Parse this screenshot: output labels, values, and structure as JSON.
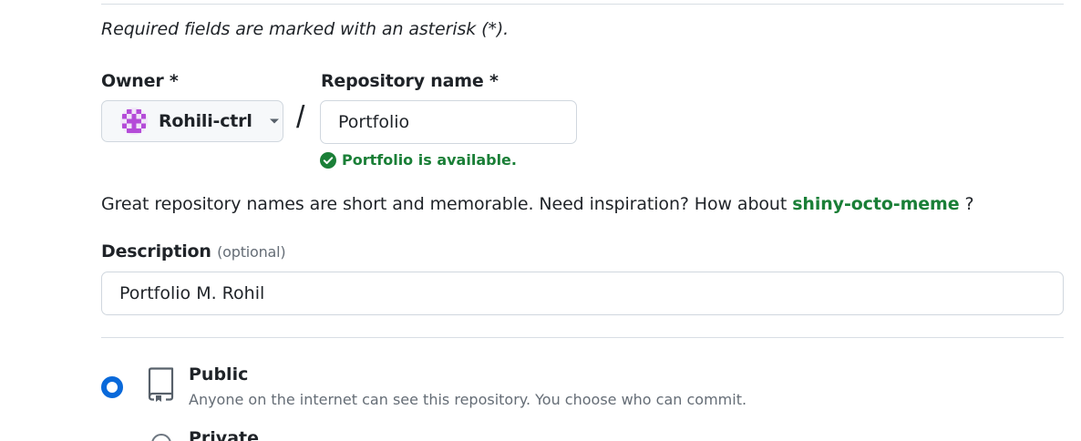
{
  "form": {
    "required_note": "Required fields are marked with an asterisk (*).",
    "owner": {
      "label": "Owner *",
      "value": "Rohili-ctrl",
      "avatar_icon": "identicon-avatar"
    },
    "separator": "/",
    "repo_name": {
      "label": "Repository name *",
      "value": "Portfolio",
      "availability": "Portfolio is available."
    },
    "inspiration": {
      "prefix": "Great repository names are short and memorable. Need inspiration? How about",
      "suggestion": "shiny-octo-meme",
      "suffix": "?"
    },
    "description": {
      "label": "Description",
      "optional_tag": "(optional)",
      "value": "Portfolio M. Rohil"
    },
    "visibility": {
      "options": [
        {
          "title": "Public",
          "description": "Anyone on the internet can see this repository. You choose who can commit.",
          "selected": true,
          "icon": "repo-icon"
        },
        {
          "title": "Private",
          "selected": false
        }
      ]
    }
  },
  "colors": {
    "success": "#1a7f37",
    "accent": "#0969da",
    "border": "#d0d7de",
    "muted": "#656d76",
    "avatar": "#b44bd8"
  }
}
